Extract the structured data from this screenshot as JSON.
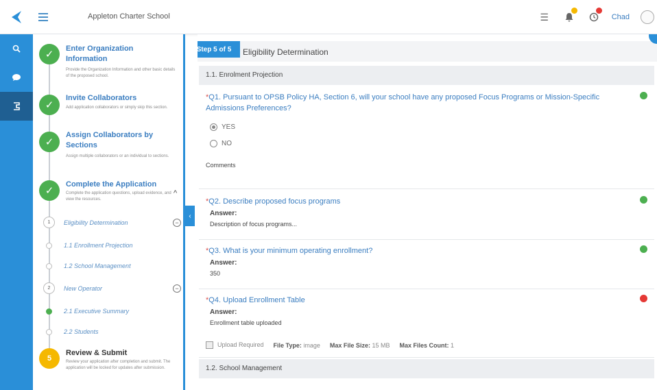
{
  "header": {
    "org_name": "Appleton Charter School",
    "user_name": "Chad",
    "colors": {
      "brand": "#2a8fd8",
      "success": "#4caf50",
      "error": "#e53935",
      "pending": "#f5b800"
    },
    "icons": [
      "logo-icon",
      "menu-icon",
      "list-icon",
      "bell-icon",
      "notification-icon",
      "user-avatar-icon"
    ]
  },
  "rail": {
    "icons": [
      "search-icon",
      "chat-icon",
      "steps-icon"
    ]
  },
  "steps": [
    {
      "title": "Enter Organization Information",
      "desc": "Provide the Organization Information and other basic details of the proposed school.",
      "status": "done"
    },
    {
      "title": "Invite Collaborators",
      "desc": "Add application collaborators or simply skip this section.",
      "status": "done"
    },
    {
      "title": "Assign Collaborators by Sections",
      "desc": "Assign multiple collaborators or an individual to sections.",
      "status": "done"
    },
    {
      "title": "Complete the Application",
      "desc": "Complete the application questions, upload evidence, and view the resources.",
      "status": "done"
    },
    {
      "title": "Review & Submit",
      "desc": "Review your application after completion and submit. The application will be locked for updates after submission.",
      "status": "pending",
      "number": "5"
    }
  ],
  "substeps": {
    "group1": {
      "number": "1",
      "label": "Eligibility Determination"
    },
    "group1_items": [
      "1.1 Enrollment Projection",
      "1.2 School Management"
    ],
    "group2": {
      "number": "2",
      "label": "New Operator"
    },
    "group2_items": [
      "2.1 Executive Summary",
      "2.2 Students"
    ]
  },
  "main": {
    "step_badge": "Step 5 of 5",
    "title": "Eligibility Determination",
    "section1": "1.1. Enrolment Projection",
    "section2": "1.2. School Management",
    "q1": {
      "req": "*",
      "text": "Q1. Pursuant to OPSB Policy HA, Section 6, will your school have any proposed Focus Programs or Mission-Specific Admissions Preferences?",
      "options": [
        "YES",
        "NO"
      ],
      "selected": "YES",
      "comments_label": "Comments",
      "status": "ok"
    },
    "q2": {
      "req": "*",
      "text": "Q2. Describe proposed focus programs",
      "answer_label": "Answer:",
      "answer": "Description of focus programs...",
      "status": "ok"
    },
    "q3": {
      "req": "*",
      "text": "Q3. What is your minimum operating enrollment?",
      "answer_label": "Answer:",
      "answer": "350",
      "status": "ok"
    },
    "q4": {
      "req": "*",
      "text": "Q4. Upload Enrollment Table",
      "answer_label": "Answer:",
      "answer": "Enrollment table uploaded",
      "upload_required": "Upload Required",
      "file_type_label": "File Type:",
      "file_type": "image",
      "max_size_label": "Max File Size:",
      "max_size": "15 MB",
      "max_count_label": "Max Files Count:",
      "max_count": "1",
      "status": "err"
    }
  }
}
